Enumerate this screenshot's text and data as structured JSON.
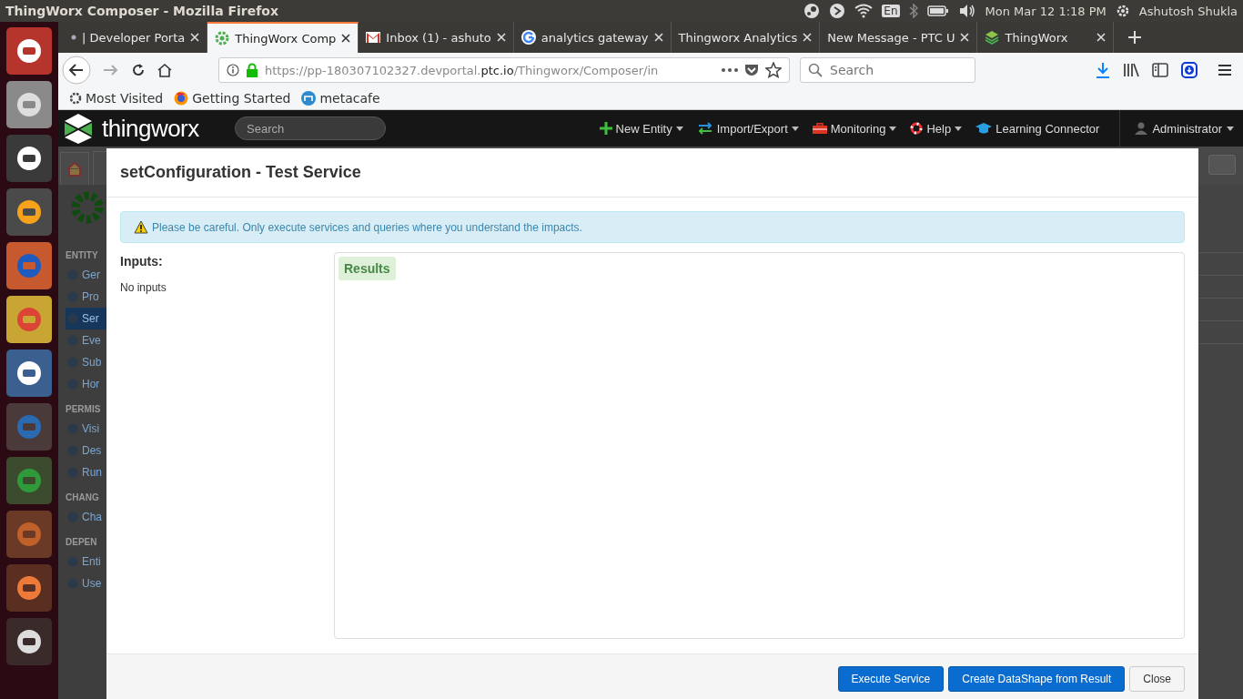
{
  "desktop_bar": {
    "window_title": "ThingWorx Composer - Mozilla Firefox",
    "keyboard": "En",
    "clock": "Mon Mar 12  1:18 PM",
    "user": "Ashutosh Shukla"
  },
  "browser": {
    "tabs": [
      {
        "label": "| Developer Porta",
        "selected": false
      },
      {
        "label": "ThingWorx Comp",
        "selected": true
      },
      {
        "label": "Inbox (1) - ashuto",
        "selected": false
      },
      {
        "label": "analytics gateway",
        "selected": false
      },
      {
        "label": "Thingworx Analytics",
        "selected": false
      },
      {
        "label": "New Message - PTC U",
        "selected": false
      },
      {
        "label": "ThingWorx",
        "selected": false
      }
    ],
    "url": {
      "prefix": "https://pp-180307102327.devportal.",
      "domain": "ptc.io",
      "path": "/Thingworx/Composer/in"
    },
    "search": {
      "placeholder": "Search"
    },
    "bookmarks": [
      "Most Visited",
      "Getting Started",
      "metacafe"
    ]
  },
  "app": {
    "logo": "thingworx",
    "search": {
      "placeholder": "Search"
    },
    "menu": [
      {
        "label": "New Entity",
        "dropdown": true
      },
      {
        "label": "Import/Export",
        "dropdown": true
      },
      {
        "label": "Monitoring",
        "dropdown": true
      },
      {
        "label": "Help",
        "dropdown": true
      },
      {
        "label": "Learning Connector",
        "dropdown": false
      }
    ],
    "user": "Administrator",
    "sidebar": [
      {
        "kind": "header",
        "label": "ENTITY"
      },
      {
        "kind": "item",
        "label": "Ger",
        "selected": false
      },
      {
        "kind": "item",
        "label": "Pro",
        "selected": false
      },
      {
        "kind": "item",
        "label": "Ser",
        "selected": true
      },
      {
        "kind": "item",
        "label": "Eve",
        "selected": false
      },
      {
        "kind": "item",
        "label": "Sub",
        "selected": false
      },
      {
        "kind": "item",
        "label": "Hor",
        "selected": false
      },
      {
        "kind": "header",
        "label": "PERMIS"
      },
      {
        "kind": "item",
        "label": "Visi",
        "selected": false
      },
      {
        "kind": "item",
        "label": "Des",
        "selected": false
      },
      {
        "kind": "item",
        "label": "Run",
        "selected": false
      },
      {
        "kind": "header",
        "label": "CHANG"
      },
      {
        "kind": "item",
        "label": "Cha",
        "selected": false
      },
      {
        "kind": "header",
        "label": "DEPEN"
      },
      {
        "kind": "item",
        "label": "Enti",
        "selected": false
      },
      {
        "kind": "item",
        "label": "Use",
        "selected": false
      }
    ]
  },
  "modal": {
    "title": "setConfiguration - Test Service",
    "warning": "Please be careful. Only execute services and queries where you understand the impacts.",
    "inputs_heading": "Inputs:",
    "inputs_text": "No inputs",
    "results_label": "Results",
    "buttons": [
      {
        "label": "Execute Service",
        "kind": "primary"
      },
      {
        "label": "Create DataShape from Result",
        "kind": "primary"
      },
      {
        "label": "Close",
        "kind": "default"
      }
    ]
  }
}
